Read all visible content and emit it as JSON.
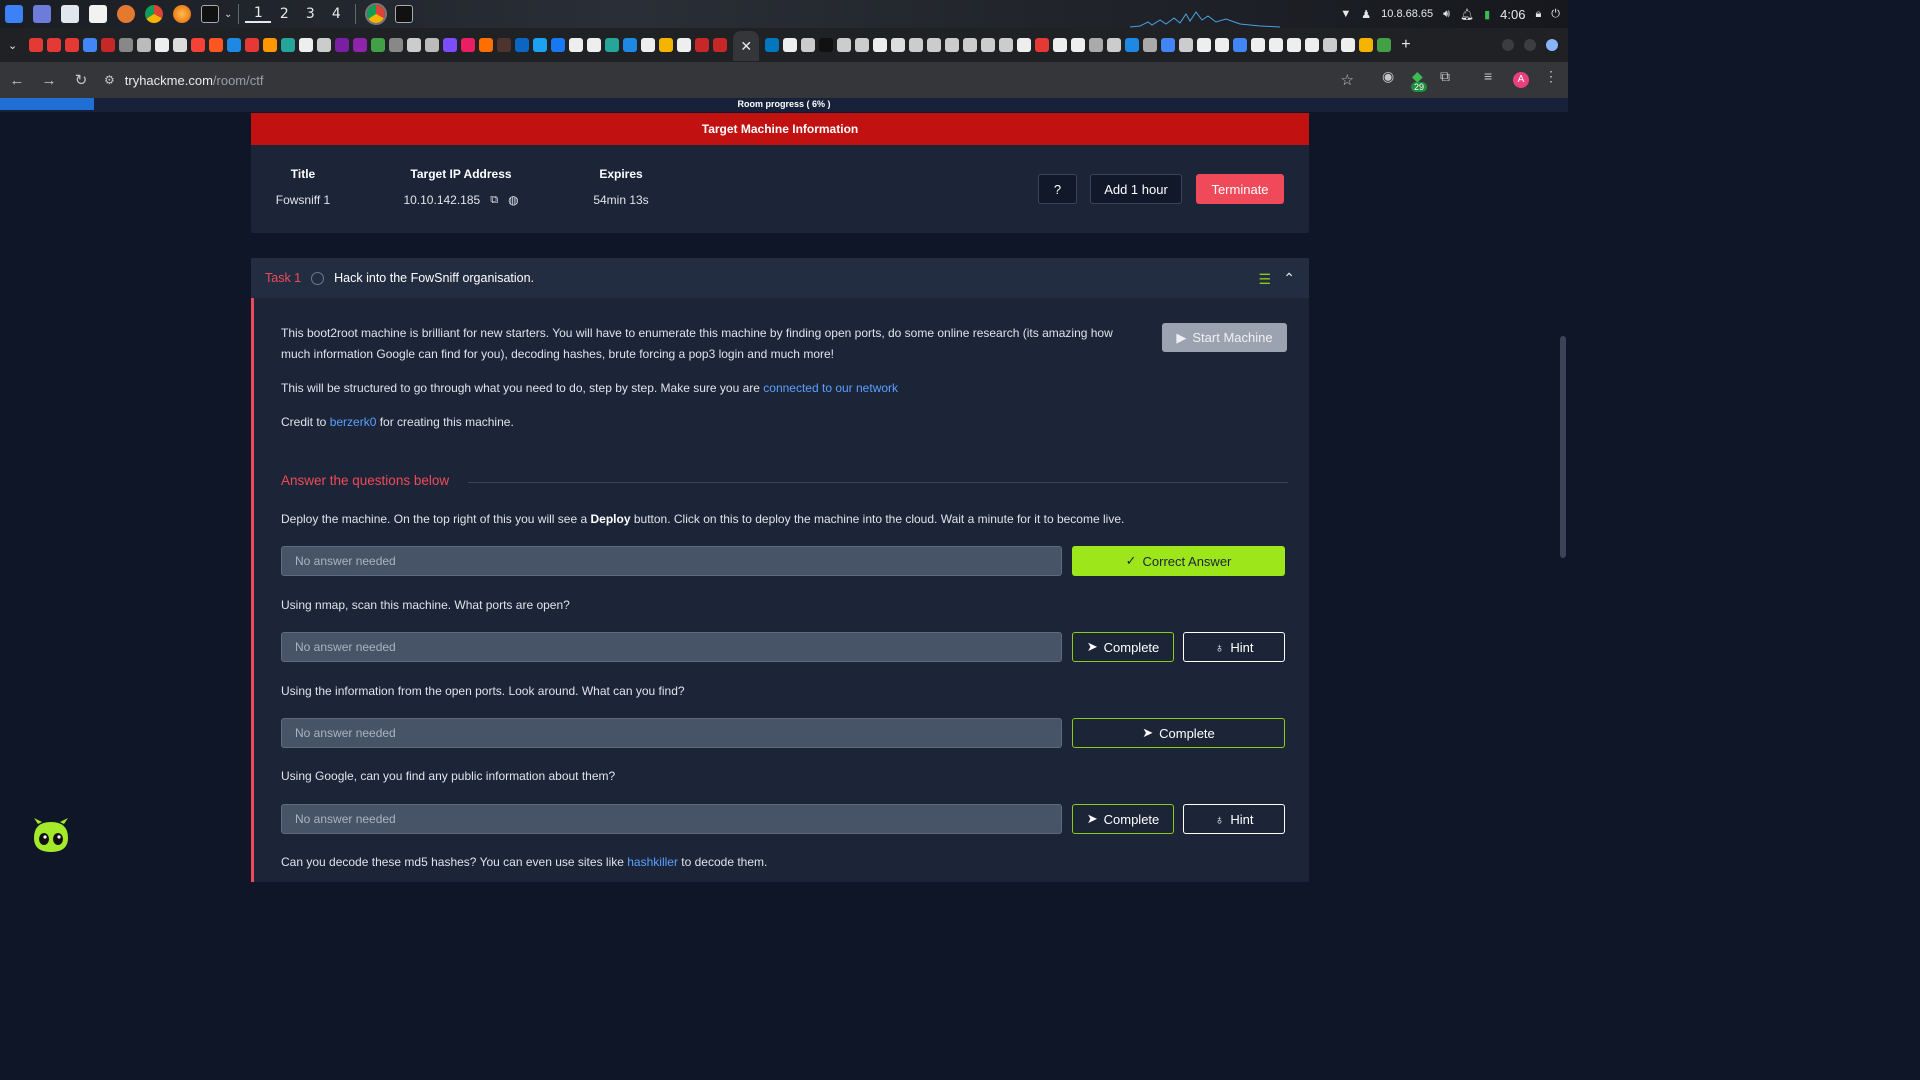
{
  "os": {
    "workspaces": [
      "1",
      "2",
      "3",
      "4"
    ],
    "ip": "10.8.68.65",
    "clock": "4:06"
  },
  "browser": {
    "url_host": "tryhackme.com",
    "url_path": "/room/ctf",
    "extension_badge": "29",
    "avatar_letter": "A"
  },
  "progress": {
    "label": "Room progress ( 6% )",
    "percent": 6
  },
  "machine": {
    "header": "Target Machine Information",
    "title_label": "Title",
    "title_value": "Fowsniff 1",
    "ip_label": "Target IP Address",
    "ip_value": "10.10.142.185",
    "expires_label": "Expires",
    "expires_value": "54min 13s",
    "help_label": "?",
    "add_hour_label": "Add 1 hour",
    "terminate_label": "Terminate"
  },
  "task": {
    "number": "Task 1",
    "title": "Hack into the FowSniff organisation.",
    "start_machine_label": "Start Machine",
    "para1_a": "This boot2root machine is brilliant for new starters. You will have to enumerate this machine by finding open ports, do some online research (its amazing how",
    "para1_b": "much information Google can find for you), decoding hashes, brute forcing a pop3 login and much more!",
    "para2_text": "This will be structured to go through what you need to do, step by step. Make sure you are ",
    "para2_link": "connected to our network",
    "para3_pre": "Credit to ",
    "para3_link": "berzerk0",
    "para3_post": " for creating this machine.",
    "section_title": "Answer the questions below",
    "questions": [
      {
        "pre": "Deploy the machine. On the top right of this you will see a ",
        "bold": "Deploy",
        "post": " button. Click on this to deploy the machine into the cloud. Wait a minute for it to become live.",
        "placeholder": "No answer needed",
        "button": "Correct Answer"
      },
      {
        "text": "Using nmap, scan this machine. What ports are open?",
        "placeholder": "No answer needed",
        "button": "Complete",
        "hint": "Hint"
      },
      {
        "text": "Using the information from the open ports. Look around. What can you find?",
        "placeholder": "No answer needed",
        "button": "Complete"
      },
      {
        "text": "Using Google, can you find any public information about them?",
        "placeholder": "No answer needed",
        "button": "Complete",
        "hint": "Hint"
      },
      {
        "pre": "Can you decode these md5 hashes? You can even use sites like ",
        "link": "hashkiller",
        "post": " to decode them."
      }
    ]
  }
}
